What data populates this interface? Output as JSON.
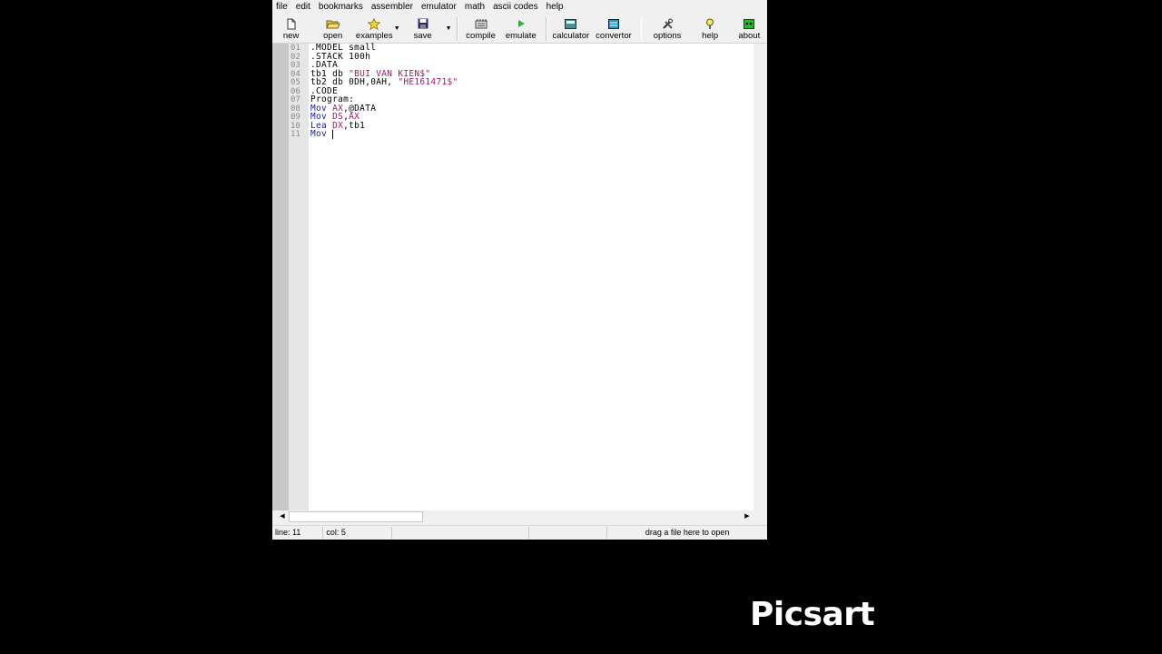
{
  "menu": [
    "file",
    "edit",
    "bookmarks",
    "assembler",
    "emulator",
    "math",
    "ascii codes",
    "help"
  ],
  "toolbar": {
    "new": "new",
    "open": "open",
    "examples": "examples",
    "save": "save",
    "compile": "compile",
    "emulate": "emulate",
    "calculator": "calculator",
    "convertor": "convertor",
    "options": "options",
    "help": "help",
    "about": "about"
  },
  "editor": {
    "line_numbers": [
      "01",
      "02",
      "03",
      "04",
      "05",
      "06",
      "07",
      "08",
      "09",
      "10",
      "11"
    ],
    "lines": {
      "l1": ".MODEL small",
      "l2": ".STACK 100h",
      "l3": ".DATA",
      "l4a": "tb1 db ",
      "l4b": "\"BUI VAN KIEN$\"",
      "l5a": "tb2 db 0DH,0AH, ",
      "l5b": "\"HE161471$\"",
      "l6": ".CODE",
      "l7": "Program:",
      "l8a": "Mov ",
      "l8b": "AX",
      "l8c": ",@DATA",
      "l9a": "Mov ",
      "l9b": "DS",
      "l9c": ",",
      "l9d": "AX",
      "l10a": "Lea ",
      "l10b": "DX",
      "l10c": ",tb1",
      "l11a": "Mov "
    }
  },
  "status": {
    "line": "line: 11",
    "col": "col: 5",
    "drop_hint": "drag a file here to open"
  },
  "watermark": "Picsart",
  "colors": {
    "keyword": "#1a1a9a",
    "register": "#9a1a6a",
    "string": "#9a1a6a",
    "emulate_icon": "#2cb52c"
  }
}
